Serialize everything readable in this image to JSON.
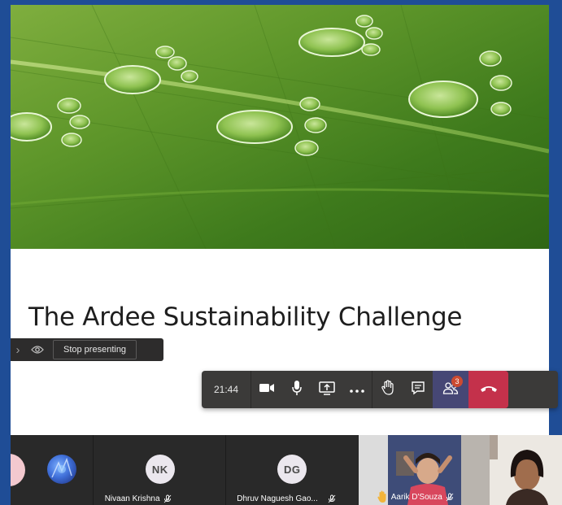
{
  "slide": {
    "title": "The Ardee Sustainability Challenge"
  },
  "presenter_bar": {
    "stop_label": "Stop presenting"
  },
  "toolbar": {
    "timer": "21:44",
    "participants_badge": "3"
  },
  "participants": [
    {
      "initials": "",
      "name": ""
    },
    {
      "initials": "",
      "name": ""
    },
    {
      "initials": "NK",
      "name": "Nivaan Krishna"
    },
    {
      "initials": "DG",
      "name": "Dhruv Naguesh Gao..."
    },
    {
      "initials": "",
      "name": "Aarik D'Souza"
    },
    {
      "initials": "",
      "name": ""
    }
  ],
  "colors": {
    "frame": "#1f4d96",
    "toolbar": "#3b3a39",
    "hangup": "#c4314b",
    "people_active": "#464775"
  }
}
